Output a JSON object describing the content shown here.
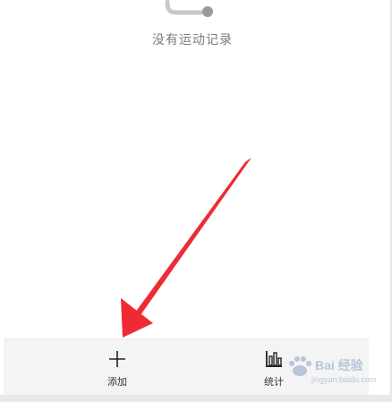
{
  "empty_state": {
    "icon": "empty-record-icon",
    "message": "没有运动记录"
  },
  "bottom_nav": {
    "items": [
      {
        "label": "添加",
        "icon": "plus-icon"
      },
      {
        "label": "统计",
        "icon": "bar-chart-icon"
      }
    ]
  },
  "watermark": {
    "brand": "Bai 经验",
    "url": "jingyan.baidu.com"
  },
  "colors": {
    "annotation_arrow": "#ee2b35",
    "bottom_bar_bg": "#f4f4f4",
    "empty_text": "#7a7a7a"
  }
}
